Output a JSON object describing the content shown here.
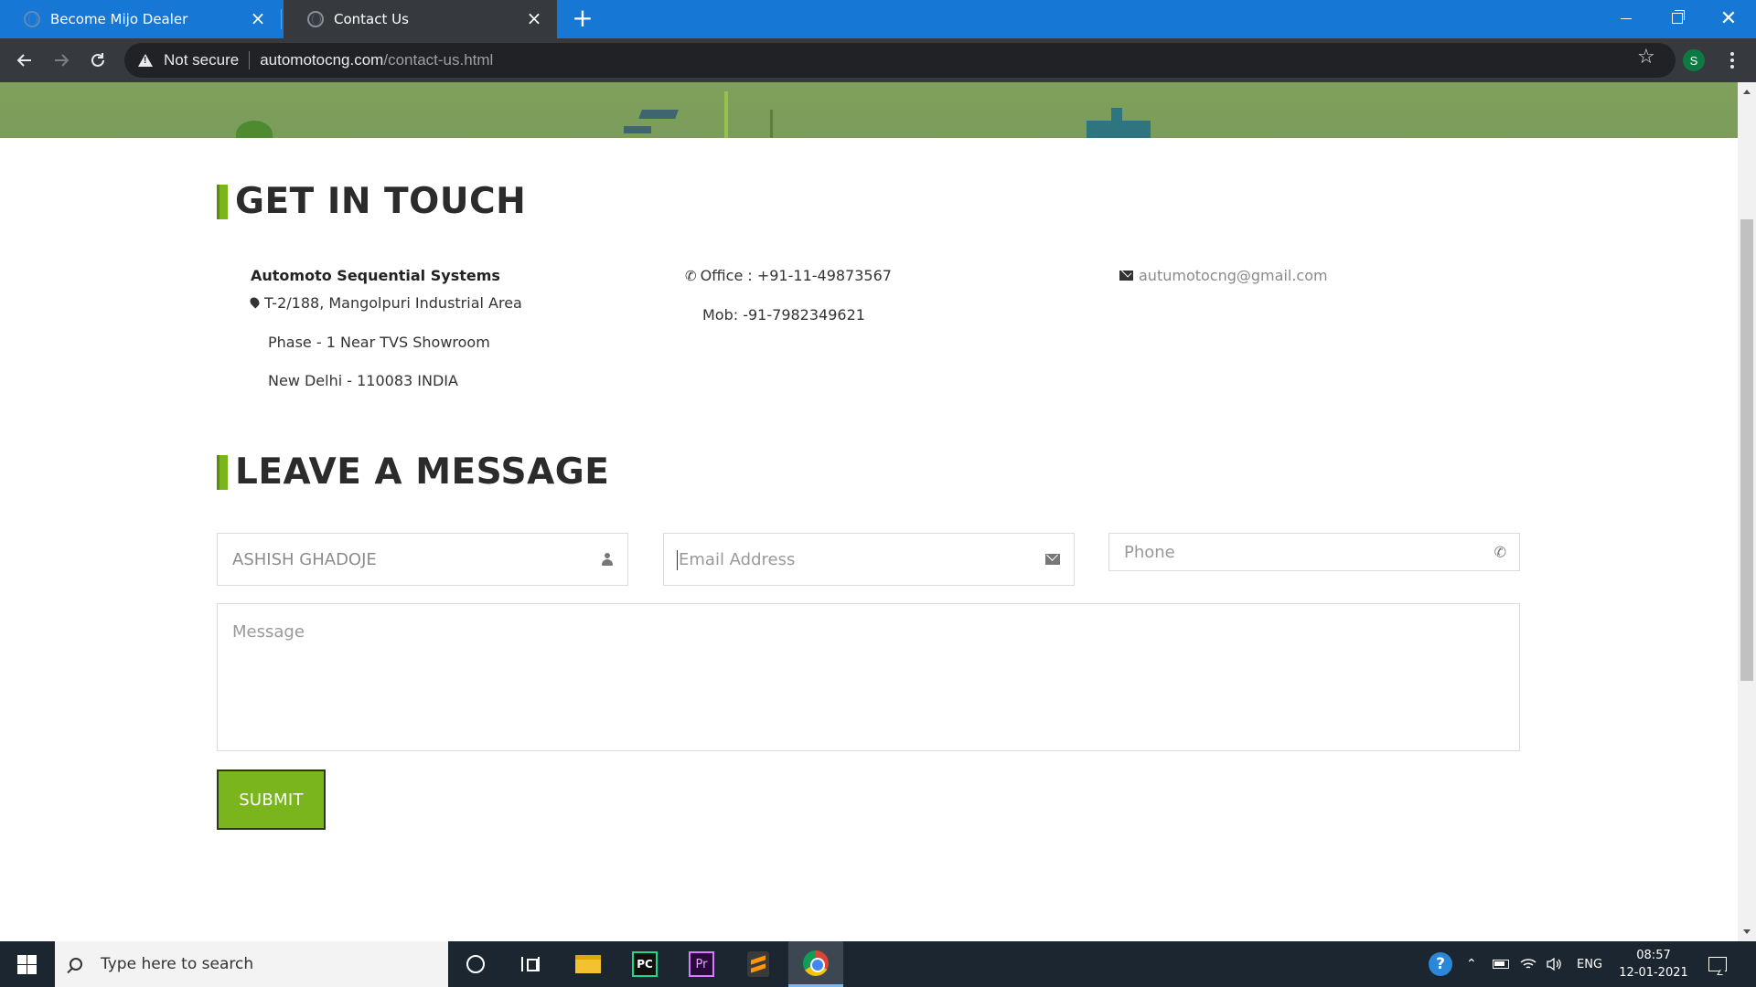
{
  "browser": {
    "tabs": [
      {
        "title": "Become Mijo Dealer",
        "active": false
      },
      {
        "title": "Contact Us",
        "active": true
      }
    ],
    "security_label": "Not secure",
    "url_host": "automotocng.com",
    "url_path": "/contact-us.html",
    "profile_initial": "S"
  },
  "contact": {
    "heading": "GET IN TOUCH",
    "company": "Automoto Sequential Systems",
    "address": [
      "T-2/188, Mangolpuri Industrial Area",
      "Phase - 1 Near TVS Showroom",
      "New Delhi - 110083 INDIA"
    ],
    "office": "Office : +91-11-49873567",
    "mobile": "Mob: -91-7982349621",
    "email": "autumotocng@gmail.com"
  },
  "form": {
    "heading": "LEAVE A MESSAGE",
    "name_value": "ASHISH GHADOJE",
    "email_placeholder": "Email Address",
    "phone_placeholder": "Phone",
    "message_placeholder": "Message",
    "submit_label": "SUBMIT"
  },
  "taskbar": {
    "search_placeholder": "Type here to search",
    "language": "ENG",
    "time": "08:57",
    "date": "12-01-2021",
    "pinned_apps": [
      "cortana-icon",
      "task-view-icon",
      "file-explorer-icon",
      "pycharm-icon",
      "premiere-icon",
      "sublime-icon",
      "chrome-icon"
    ],
    "pycharm_label": "PC",
    "premiere_label": "Pr"
  },
  "colors": {
    "tabbar": "#1777d4",
    "accent_green": "#7ab51d",
    "heading": "#2b2b2b",
    "taskbar": "#1c2631"
  }
}
